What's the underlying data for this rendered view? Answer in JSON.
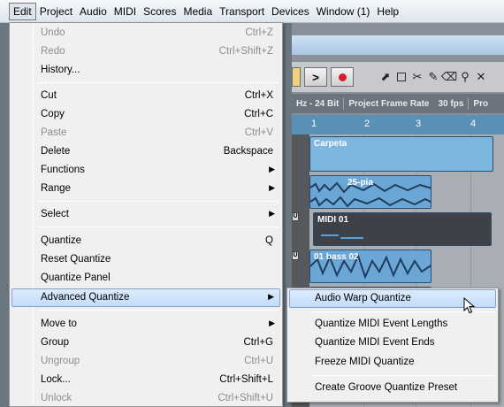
{
  "menubar": {
    "items": [
      "Edit",
      "Project",
      "Audio",
      "MIDI",
      "Scores",
      "Media",
      "Transport",
      "Devices",
      "Window (1)",
      "Help"
    ]
  },
  "app": {
    "info_bar": {
      "sample_format": "Hz - 24 Bit",
      "frame_rate_label": "Project Frame Rate",
      "frame_rate_value": "30 fps",
      "trailing": "Pro"
    },
    "ruler": [
      "1",
      "2",
      "3",
      "4"
    ],
    "events": {
      "folder": "Carpeta",
      "audio1": "25-pia",
      "midi": "MIDI 01",
      "bass": "01 bass 02"
    },
    "track_button_label": "U",
    "colors": {
      "folder_event": "#7fb6e0",
      "audio_event": "#6aa6d6",
      "midi_event": "#3c4247",
      "ruler": "#5a8fb6"
    }
  },
  "edit_menu": {
    "undo": {
      "label": "Undo",
      "shortcut": "Ctrl+Z"
    },
    "redo": {
      "label": "Redo",
      "shortcut": "Ctrl+Shift+Z"
    },
    "history": {
      "label": "History..."
    },
    "cut": {
      "label": "Cut",
      "shortcut": "Ctrl+X"
    },
    "copy": {
      "label": "Copy",
      "shortcut": "Ctrl+C"
    },
    "paste": {
      "label": "Paste",
      "shortcut": "Ctrl+V"
    },
    "delete": {
      "label": "Delete",
      "shortcut": "Backspace"
    },
    "functions": {
      "label": "Functions"
    },
    "range": {
      "label": "Range"
    },
    "select": {
      "label": "Select"
    },
    "quantize": {
      "label": "Quantize",
      "shortcut": "Q"
    },
    "reset_quantize": {
      "label": "Reset Quantize"
    },
    "quantize_panel": {
      "label": "Quantize Panel"
    },
    "advanced_quantize": {
      "label": "Advanced Quantize"
    },
    "move_to": {
      "label": "Move to"
    },
    "group": {
      "label": "Group",
      "shortcut": "Ctrl+G"
    },
    "ungroup": {
      "label": "Ungroup",
      "shortcut": "Ctrl+U"
    },
    "lock": {
      "label": "Lock...",
      "shortcut": "Ctrl+Shift+L"
    },
    "unlock": {
      "label": "Unlock",
      "shortcut": "Ctrl+Shift+U"
    }
  },
  "advanced_quantize_submenu": {
    "audio_warp": "Audio Warp Quantize",
    "midi_lengths": "Quantize MIDI Event Lengths",
    "midi_ends": "Quantize MIDI Event Ends",
    "freeze": "Freeze MIDI Quantize",
    "groove_preset": "Create Groove Quantize Preset"
  }
}
